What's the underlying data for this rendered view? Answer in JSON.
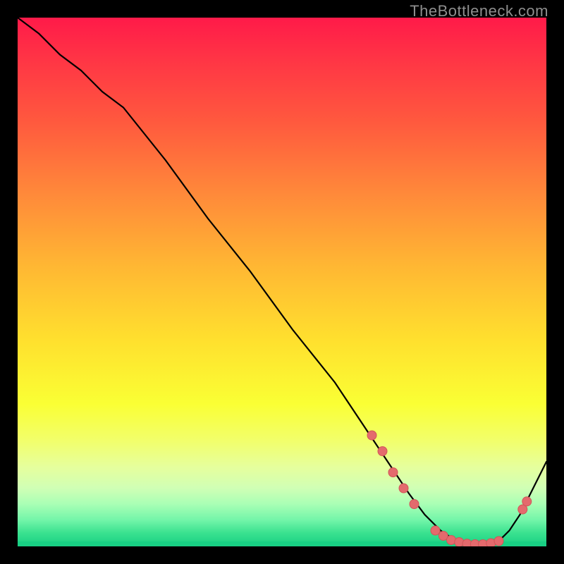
{
  "watermark": "TheBottleneck.com",
  "axes": {
    "x_range": [
      0,
      100
    ],
    "y_range": [
      0,
      100
    ]
  },
  "chart_data": {
    "type": "line",
    "title": "",
    "xlabel": "",
    "ylabel": "",
    "xlim": [
      0,
      100
    ],
    "ylim": [
      0,
      100
    ],
    "grid": false,
    "series": [
      {
        "name": "bottleneck-curve",
        "x": [
          0,
          4,
          8,
          12,
          16,
          20,
          28,
          36,
          44,
          52,
          60,
          66,
          70,
          74,
          77,
          80,
          83,
          85,
          87,
          89,
          91,
          93,
          95,
          97,
          100
        ],
        "y": [
          100,
          97,
          93,
          90,
          86,
          83,
          73,
          62,
          52,
          41,
          31,
          22,
          16,
          10,
          6,
          3,
          1,
          0.5,
          0.3,
          0.4,
          1,
          3,
          6,
          10,
          16
        ]
      }
    ],
    "markers": [
      {
        "x": 67,
        "y": 21
      },
      {
        "x": 69,
        "y": 18
      },
      {
        "x": 71,
        "y": 14
      },
      {
        "x": 73,
        "y": 11
      },
      {
        "x": 75,
        "y": 8
      },
      {
        "x": 79,
        "y": 3
      },
      {
        "x": 80.5,
        "y": 2
      },
      {
        "x": 82,
        "y": 1.2
      },
      {
        "x": 83.5,
        "y": 0.8
      },
      {
        "x": 85,
        "y": 0.5
      },
      {
        "x": 86.5,
        "y": 0.4
      },
      {
        "x": 88,
        "y": 0.4
      },
      {
        "x": 89.5,
        "y": 0.6
      },
      {
        "x": 91,
        "y": 1.0
      },
      {
        "x": 95.5,
        "y": 7
      },
      {
        "x": 96.3,
        "y": 8.5
      }
    ]
  },
  "colors": {
    "curve_stroke": "#000000",
    "marker_fill": "#e46a6d",
    "marker_stroke": "#d15558"
  }
}
